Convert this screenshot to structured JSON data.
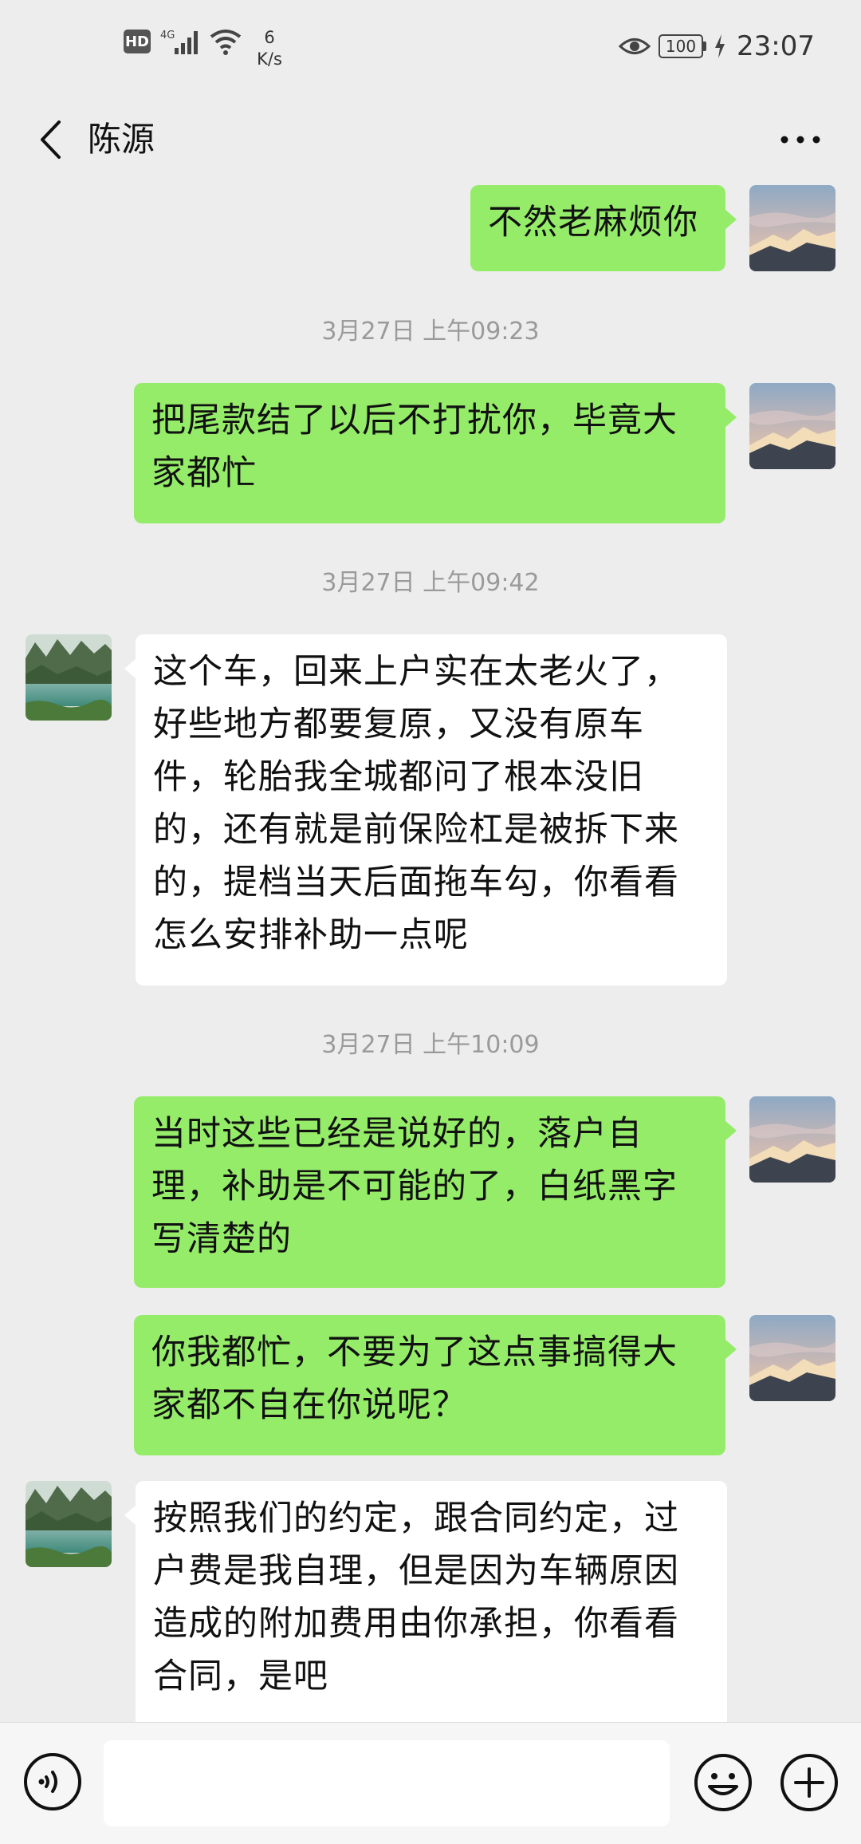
{
  "status_bar": {
    "hd": "HD",
    "network": "4G",
    "speed_value": "6",
    "speed_unit": "K/s",
    "battery": "100",
    "time": "23:07"
  },
  "header": {
    "title": "陈源"
  },
  "messages": [
    {
      "type": "sent",
      "text": "不然老麻烦你"
    },
    {
      "type": "time",
      "text": "3月27日 上午09:23"
    },
    {
      "type": "sent",
      "text": "把尾款结了以后不打扰你，毕竟大家都忙"
    },
    {
      "type": "time",
      "text": "3月27日 上午09:42"
    },
    {
      "type": "recv",
      "text": "这个车，回来上户实在太老火了，好些地方都要复原，又没有原车件，轮胎我全城都问了根本没旧的，还有就是前保险杠是被拆下来的，提档当天后面拖车勾，你看看怎么安排补助一点呢"
    },
    {
      "type": "time",
      "text": "3月27日 上午10:09"
    },
    {
      "type": "sent",
      "text": "当时这些已经是说好的，落户自理，补助是不可能的了，白纸黑字写清楚的"
    },
    {
      "type": "sent",
      "text": "你我都忙，不要为了这点事搞得大家都不自在你说呢？"
    },
    {
      "type": "recv",
      "text": "按照我们的约定，跟合同约定，过户费是我自理，但是因为车辆原因造成的附加费用由你承担，你看看合同，是吧"
    }
  ],
  "input": {
    "placeholder": ""
  },
  "colors": {
    "sent_bubble": "#95ec69",
    "recv_bubble": "#ffffff",
    "background": "#ededed"
  },
  "icons": [
    "back-icon",
    "more-icon",
    "voice-icon",
    "emoji-icon",
    "plus-icon",
    "eye-icon",
    "wifi-icon",
    "signal-icon",
    "charging-icon"
  ]
}
